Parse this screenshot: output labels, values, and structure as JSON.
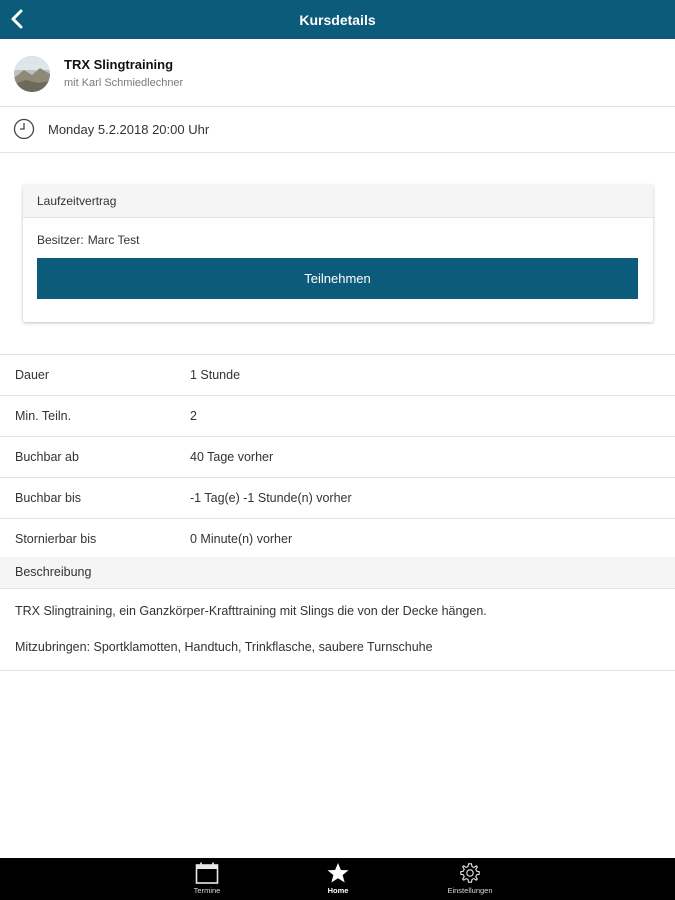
{
  "header": {
    "title": "Kursdetails",
    "back_icon": "chevron-left-icon"
  },
  "course": {
    "title": "TRX Slingtraining",
    "subtitle": "mit Karl Schmiedlechner"
  },
  "schedule": {
    "datetime": "Monday 5.2.2018 20:00 Uhr",
    "icon": "clock-icon"
  },
  "contract": {
    "title": "Laufzeitvertrag",
    "owner_label": "Besitzer:",
    "owner_name": "Marc Test",
    "join_label": "Teilnehmen"
  },
  "details": [
    {
      "key": "Dauer",
      "value": "1 Stunde"
    },
    {
      "key": "Min. Teiln.",
      "value": "2"
    },
    {
      "key": "Buchbar ab",
      "value": "40 Tage vorher"
    },
    {
      "key": "Buchbar bis",
      "value": "-1 Tag(e) -1 Stunde(n) vorher"
    },
    {
      "key": "Stornierbar bis",
      "value": "0 Minute(n) vorher"
    }
  ],
  "description": {
    "header": "Beschreibung",
    "paragraphs": [
      "TRX Slingtraining, ein Ganzkörper-Krafttraining mit Slings die von der Decke hängen.",
      "Mitzubringen: Sportklamotten, Handtuch, Trinkflasche, saubere Turnschuhe"
    ]
  },
  "tabbar": {
    "items": [
      {
        "label": "Termine",
        "icon": "calendar-icon"
      },
      {
        "label": "Home",
        "icon": "star-icon",
        "active": true
      },
      {
        "label": "Einstellungen",
        "icon": "gear-icon"
      }
    ]
  },
  "colors": {
    "primary": "#0d5b7a",
    "tabbar": "#000000"
  }
}
